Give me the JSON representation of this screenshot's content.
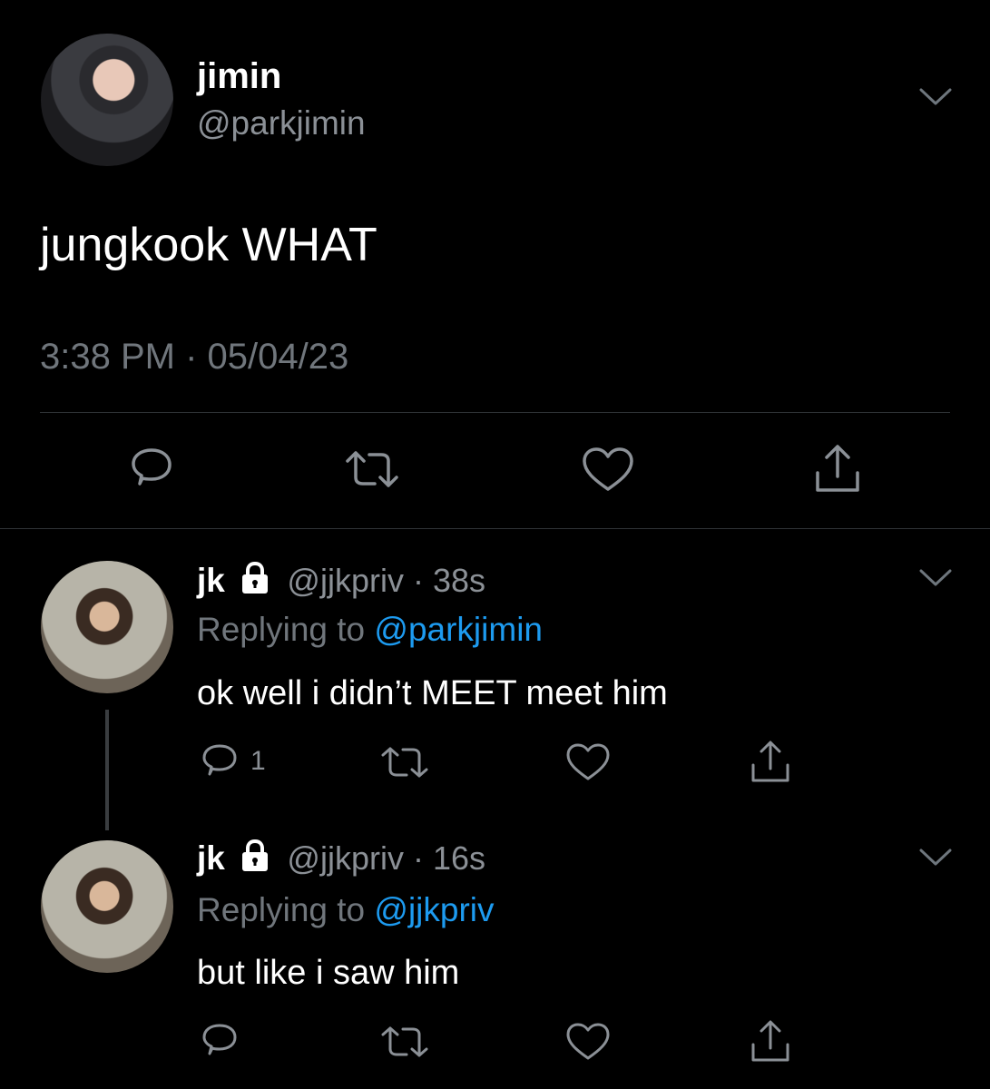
{
  "main_tweet": {
    "name": "jimin",
    "handle": "@parkjimin",
    "text": "jungkook WHAT",
    "timestamp": "3:38 PM · 05/04/23",
    "actions": [
      "reply-icon",
      "retweet-icon",
      "like-icon",
      "share-icon"
    ]
  },
  "replies": [
    {
      "name": "jk",
      "locked": true,
      "handle": "@jjkpriv",
      "separator": " · ",
      "age": "38s",
      "replying_prefix": "Replying to ",
      "replying_to": "@parkjimin",
      "text": "ok well i didn’t MEET meet him",
      "reply_count": "1"
    },
    {
      "name": "jk",
      "locked": true,
      "handle": "@jjkpriv",
      "separator": " · ",
      "age": "16s",
      "replying_prefix": "Replying to ",
      "replying_to": "@jjkpriv",
      "text": "but like i saw him",
      "reply_count": ""
    }
  ],
  "colors": {
    "background": "#000000",
    "accent": "#1d9bf0",
    "muted": "#70767c",
    "icon": "#8b9096"
  }
}
